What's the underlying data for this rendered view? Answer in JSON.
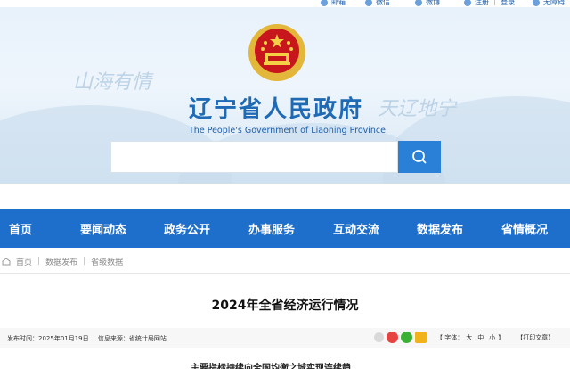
{
  "topbar": {
    "links": [
      {
        "label": "邮箱",
        "icon": "mail-icon"
      },
      {
        "label": "微信",
        "icon": "wechat-icon"
      },
      {
        "label": "微博",
        "icon": "weibo-icon"
      },
      {
        "label": "注册 ｜ 登录",
        "icon": "user-icon"
      },
      {
        "label": "无障碍",
        "icon": "accessibility-icon"
      }
    ]
  },
  "header": {
    "title": "辽宁省人民政府",
    "subtitle": "The People's Government of Liaoning Province",
    "brush_left": "山海有情",
    "brush_right": "天辽地宁"
  },
  "search": {
    "placeholder": "",
    "icon": "search-icon"
  },
  "nav": {
    "items": [
      "首页",
      "要闻动态",
      "政务公开",
      "办事服务",
      "互动交流",
      "数据发布",
      "省情概况"
    ]
  },
  "breadcrumb": [
    "首页",
    "数据发布",
    "省级数据"
  ],
  "article": {
    "title": "2024年全省经济运行情况",
    "publish_time": "发布时间：2025年01月19日",
    "source": "信息来源：省统计局网站",
    "font_label": "【 字体：",
    "font_sizes": [
      "大",
      "中",
      "小"
    ],
    "font_close": "】",
    "print": "【打印文章】",
    "first_line": "主要指标持续向全国均衡之城实现连续趋"
  },
  "colors": {
    "nav": "#1e6fcb",
    "accent": "#2a7fd6",
    "title": "#1f6ab4"
  }
}
